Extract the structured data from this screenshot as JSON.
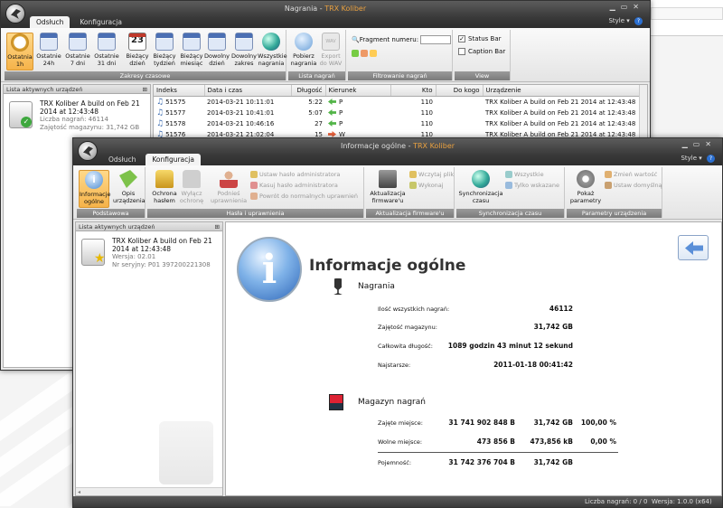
{
  "back_window": {
    "title": "Nagrania",
    "title_app": "TRX Koliber",
    "tabs": [
      "Odsłuch",
      "Konfiguracja"
    ],
    "style_label": "Style",
    "help": "?",
    "ribbon": {
      "buttons": [
        {
          "label1": "Ostatnia",
          "label2": "1h"
        },
        {
          "label1": "Ostatnie",
          "label2": "24h"
        },
        {
          "label1": "Ostatnie",
          "label2": "7 dni"
        },
        {
          "label1": "Ostatnie",
          "label2": "31 dni"
        },
        {
          "label1": "Bieżący",
          "label2": "dzień"
        },
        {
          "label1": "Bieżący",
          "label2": "tydzień"
        },
        {
          "label1": "Bieżący",
          "label2": "miesiąc"
        },
        {
          "label1": "Dowolny",
          "label2": "dzień"
        },
        {
          "label1": "Dowolny",
          "label2": "zakres"
        },
        {
          "label1": "Wszystkie",
          "label2": "nagrania"
        }
      ],
      "day_number": "23",
      "group1_label": "Zakresy czasowe",
      "fetch_label1": "Pobierz",
      "fetch_label2": "nagrania",
      "export_label1": "Export",
      "export_label2": "do WAV",
      "group2_label": "Lista nagrań",
      "fragment_label": "Fragment numeru:",
      "group3_label": "Filtrowanie nagrań",
      "status_bar_label": "Status Bar",
      "caption_bar_label": "Caption Bar",
      "group4_label": "View"
    },
    "devices_panel_title": "Lista aktywnych urządzeń",
    "device": {
      "name": "TRX Koliber A build on Feb 21 2014 at 12:43:48",
      "count": "Liczba nagrań: 46114",
      "storage": "Zajętość magazynu: 31,742 GB"
    },
    "table": {
      "headers": [
        "Indeks",
        "Data i czas",
        "Długość",
        "Kierunek",
        "Kto",
        "Do kogo",
        "Urządzenie"
      ],
      "rows": [
        {
          "idx": "51575",
          "date": "2014-03-21 10:11:01",
          "len": "5:22",
          "dir": "P",
          "who": "110",
          "to": "",
          "dev": "TRX Koliber A build on Feb 21 2014 at 12:43:48"
        },
        {
          "idx": "51577",
          "date": "2014-03-21 10:41:01",
          "len": "5:07",
          "dir": "P",
          "who": "110",
          "to": "",
          "dev": "TRX Koliber A build on Feb 21 2014 at 12:43:48"
        },
        {
          "idx": "51578",
          "date": "2014-03-21 10:46:16",
          "len": "27",
          "dir": "P",
          "who": "110",
          "to": "",
          "dev": "TRX Koliber A build on Feb 21 2014 at 12:43:48"
        },
        {
          "idx": "51576",
          "date": "2014-03-21 21:02:04",
          "len": "15",
          "dir": "W",
          "who": "110",
          "to": "",
          "dev": "TRX Koliber A build on Feb 21 2014 at 12:43:48"
        }
      ]
    }
  },
  "front_window": {
    "title": "Informacje ogólne",
    "title_app": "TRX Koliber",
    "tabs": [
      "Odsłuch",
      "Konfiguracja"
    ],
    "style_label": "Style",
    "help": "?",
    "ribbon": {
      "info_label1": "Informacje",
      "info_label2": "ogólne",
      "desc_label1": "Opis",
      "desc_label2": "urządzenia",
      "group1_label": "Podstawowa",
      "pwd_label1": "Ochrona",
      "pwd_label2": "hasłem",
      "nopwd_label1": "Wyłącz",
      "nopwd_label2": "ochronę",
      "admin_label1": "Podnieś",
      "admin_label2": "uprawnienia",
      "set_admin_pwd": "Ustaw hasło administratora",
      "clear_admin_pwd": "Kasuj hasło administratora",
      "back_normal": "Powrót do normalnych uprawnień",
      "group2_label": "Hasła i uprawnienia",
      "fw_label1": "Aktualizacja",
      "fw_label2": "firmware'u",
      "load_file": "Wczytaj plik",
      "execute": "Wykonaj",
      "group3_label": "Aktualizacja firmware'u",
      "sync_label1": "Synchronizacja",
      "sync_label2": "czasu",
      "all": "Wszystkie",
      "only_selected": "Tylko wskazane",
      "group4_label": "Synchronizacja czasu",
      "params_label1": "Pokaż",
      "params_label2": "parametry",
      "change_value": "Zmień wartość",
      "set_default": "Ustaw domyślną",
      "group5_label": "Parametry urządzenia"
    },
    "devices_panel_title": "Lista aktywnych urządzeń",
    "device": {
      "name": "TRX Koliber A build on Feb 21 2014 at 12:43:48",
      "version": "Wersja: 02.01",
      "serial": "Nr seryjny: P01 397200221308"
    },
    "info": {
      "heading": "Informacje ogólne",
      "recordings_title": "Nagrania",
      "rows": [
        {
          "label": "Ilość wszystkich nagrań:",
          "value": "46112"
        },
        {
          "label": "Zajętość magazynu:",
          "value": "31,742 GB"
        },
        {
          "label": "Całkowita długość:",
          "value": "1089 godzin 43 minut 12 sekund"
        },
        {
          "label": "Najstarsze:",
          "value": "2011-01-18 00:41:42"
        }
      ],
      "storage_title": "Magazyn nagrań",
      "storage_rows": [
        {
          "label": "Zajęte miejsce:",
          "bytes": "31 741 902 848 B",
          "gb": "31,742 GB",
          "pct": "100,00 %"
        },
        {
          "label": "Wolne miejsce:",
          "bytes": "473 856 B",
          "gb": "473,856 kB",
          "pct": "0,00 %"
        },
        {
          "label": "Pojemność:",
          "bytes": "31 742 376 704 B",
          "gb": "31,742 GB",
          "pct": ""
        }
      ]
    },
    "status": {
      "count": "Liczba nagrań: 0 / 0",
      "version": "Wersja: 1.0.0 (x64)"
    }
  }
}
